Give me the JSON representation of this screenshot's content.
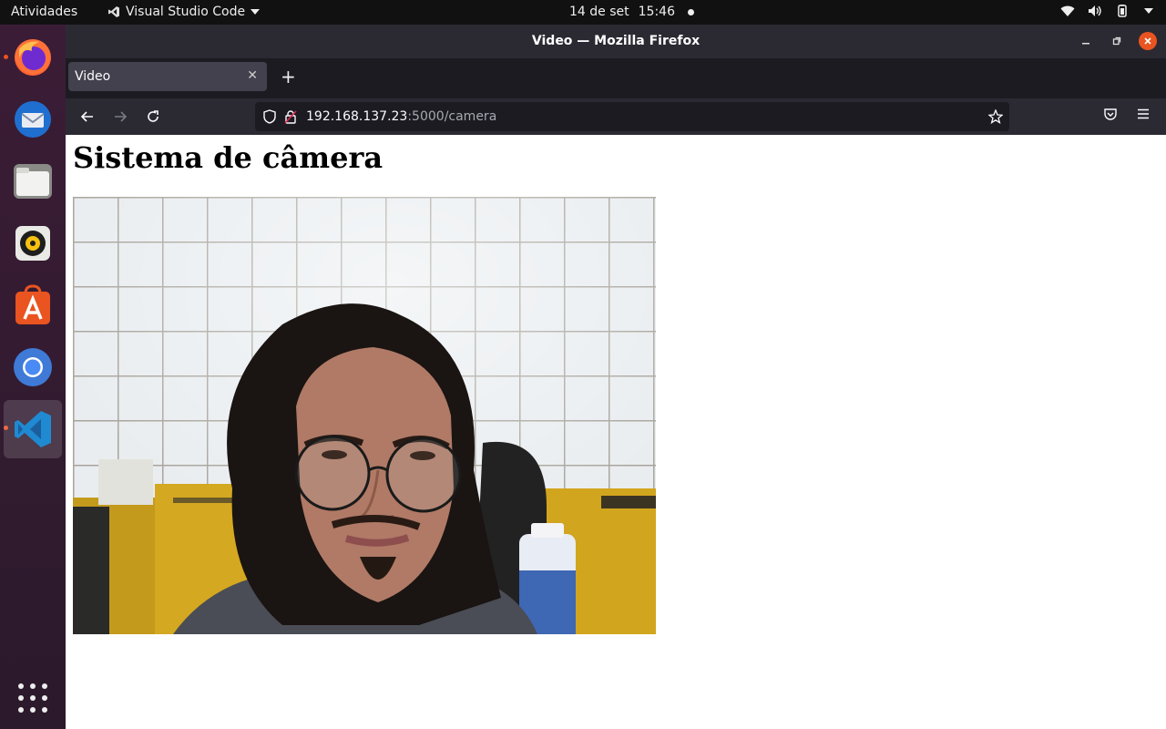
{
  "topbar": {
    "activities": "Atividades",
    "app_name": "Visual Studio Code",
    "date": "14 de set",
    "time": "15:46"
  },
  "dock": {
    "items": [
      "firefox-icon",
      "thunderbird-icon",
      "files-icon",
      "rhythmbox-icon",
      "app-center-icon",
      "chromium-icon",
      "vscode-icon"
    ]
  },
  "window": {
    "title": "Video — Mozilla Firefox"
  },
  "tabs": [
    {
      "label": "Video"
    }
  ],
  "urlbar": {
    "host": "192.168.137.23",
    "path": ":5000/camera"
  },
  "page": {
    "heading": "Sistema de câmera"
  },
  "colors": {
    "firefox_dark": "#2b2a33",
    "tabbar": "#1c1b22",
    "ubuntu_orange": "#e95420",
    "dock": "#3b1c36"
  }
}
